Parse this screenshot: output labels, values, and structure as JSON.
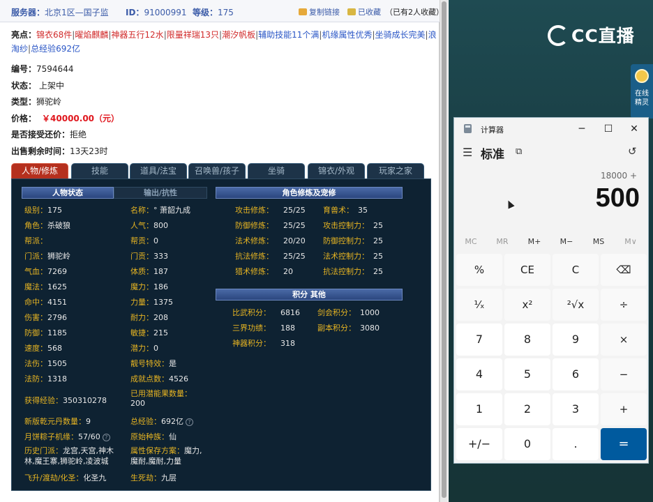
{
  "topbar": {
    "server_label": "服务器：",
    "server_value": "北京1区—国子监",
    "id_label": "ID：",
    "id_value": "91000991",
    "level_label": "等级：",
    "level_value": "175",
    "copy_link": "复制链接",
    "collected": "已收藏",
    "collect_count": "（已有2人收藏）"
  },
  "highlights": {
    "label": "亮点：",
    "items": [
      "锦衣68件",
      "曜焰麒麟",
      "神器五行12水",
      "限量祥瑞13只",
      "潮汐帆板",
      "辅助技能11个满",
      "机缘属性优秀",
      "坐骑成长完美",
      "浪淘纱",
      "总经验692亿"
    ],
    "sep": "|"
  },
  "info": {
    "number_label": "编号：",
    "number_value": "7594644",
    "status_label": "状态：",
    "status_value": "上架中",
    "type_label": "类型：",
    "type_value": "狮驼岭",
    "price_label": "价格：",
    "price_value": "￥40000.00（元）",
    "bargain_label": "是否接受还价：",
    "bargain_value": "拒绝",
    "time_label": "出售剩余时间：",
    "time_value": "13天23时"
  },
  "tabs": [
    "人物/修炼",
    "技能",
    "道具/法宝",
    "召唤兽/孩子",
    "坐骑",
    "锦衣/外观",
    "玩家之家"
  ],
  "panel": {
    "section_status": "人物状态",
    "section_output": "输出/抗性",
    "section_cultivation": "角色修炼及宠修",
    "section_score": "积分 其他",
    "left_col": [
      {
        "k": "级别：",
        "v": "175"
      },
      {
        "k": "角色：",
        "v": "杀破狼"
      },
      {
        "k": "帮派：",
        "v": ""
      },
      {
        "k": "门派：",
        "v": "狮驼岭"
      },
      {
        "k": "气血：",
        "v": "7269"
      },
      {
        "k": "魔法：",
        "v": "1625"
      },
      {
        "k": "命中：",
        "v": "4151"
      },
      {
        "k": "伤害：",
        "v": "2796"
      },
      {
        "k": "防御：",
        "v": "1185"
      },
      {
        "k": "速度：",
        "v": "568"
      },
      {
        "k": "法伤：",
        "v": "1505"
      },
      {
        "k": "法防：",
        "v": "1318"
      }
    ],
    "right_col": [
      {
        "k": "名称：",
        "v": "° 萧韶九成"
      },
      {
        "k": "人气：",
        "v": "800"
      },
      {
        "k": "帮贡：",
        "v": "0"
      },
      {
        "k": "门贡：",
        "v": "333"
      },
      {
        "k": "体质：",
        "v": "187"
      },
      {
        "k": "魔力：",
        "v": "186"
      },
      {
        "k": "力量：",
        "v": "1375"
      },
      {
        "k": "耐力：",
        "v": "208"
      },
      {
        "k": "敏捷：",
        "v": "215"
      },
      {
        "k": "潜力：",
        "v": "0"
      },
      {
        "k": "靓号特效：",
        "v": "是"
      },
      {
        "k": "成就点数：",
        "v": "4526"
      }
    ],
    "exp_label": "获得经验：",
    "exp_value": "350310278",
    "potential_label": "已用潜能果数量：",
    "potential_value": "200",
    "qianyuan_label": "新版乾元丹数量：",
    "qianyuan_value": "9",
    "total_exp_label": "总经验：",
    "total_exp_value": "692亿",
    "mooncake_label": "月饼粽子机缘：",
    "mooncake_value": "57/60",
    "race_label": "原始种族：",
    "race_value": "仙",
    "history_label": "历史门派：",
    "history_value": "龙宫,天宫,神木林,魔王寨,狮驼岭,凌波城",
    "attr_label": "属性保存方案：",
    "attr_value": "魔力,魔耐,魔耐,力量",
    "fly_label": "飞升/渡劫/化圣：",
    "fly_value": "化圣九",
    "life_label": "生死劫：",
    "life_value": "九层",
    "cultivation_left": [
      {
        "k": "攻击修炼：",
        "v": "25/25"
      },
      {
        "k": "防御修炼：",
        "v": "25/25"
      },
      {
        "k": "法术修炼：",
        "v": "20/20"
      },
      {
        "k": "抗法修炼：",
        "v": "25/25"
      },
      {
        "k": "猎术修炼：",
        "v": "20"
      }
    ],
    "cultivation_right": [
      {
        "k": "育兽术：",
        "v": "35"
      },
      {
        "k": "攻击控制力：",
        "v": "25"
      },
      {
        "k": "防御控制力：",
        "v": "25"
      },
      {
        "k": "法术控制力：",
        "v": "25"
      },
      {
        "k": "抗法控制力：",
        "v": "25"
      }
    ],
    "score_left": [
      {
        "k": "比武积分：",
        "v": "6816"
      },
      {
        "k": "三界功绩：",
        "v": "188"
      },
      {
        "k": "神器积分：",
        "v": "318"
      }
    ],
    "score_right": [
      {
        "k": "剑会积分：",
        "v": "1000"
      },
      {
        "k": "副本积分：",
        "v": "3080"
      }
    ]
  },
  "desktop": {
    "logo_text": "CC直播",
    "sprite_text_1": "在线",
    "sprite_text_2": "精灵"
  },
  "calculator": {
    "title": "计算器",
    "mode": "标准",
    "expression": "18000 +",
    "display": "500",
    "memory": [
      "MC",
      "MR",
      "M+",
      "M−",
      "MS",
      "M∨"
    ],
    "keys": [
      [
        "%",
        "CE",
        "C",
        "⌫"
      ],
      [
        "¹⁄ₓ",
        "x²",
        "²√x",
        "÷"
      ],
      [
        "7",
        "8",
        "9",
        "×"
      ],
      [
        "4",
        "5",
        "6",
        "−"
      ],
      [
        "1",
        "2",
        "3",
        "+"
      ],
      [
        "+/−",
        "0",
        ".",
        "="
      ]
    ]
  }
}
